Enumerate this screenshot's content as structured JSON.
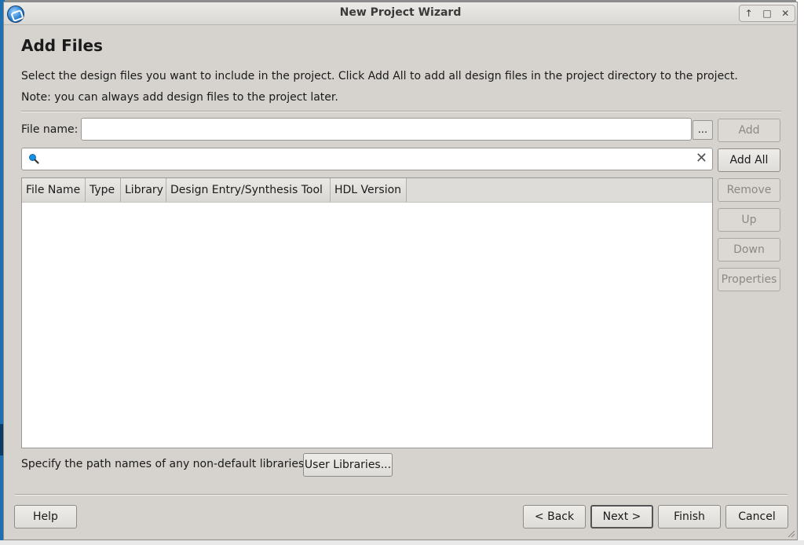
{
  "window": {
    "title": "New Project Wizard",
    "controls": {
      "up": "↑",
      "maximize": "□",
      "close": "✕"
    }
  },
  "page": {
    "heading": "Add Files",
    "description_line1": "Select the design files you want to include in the project. Click Add All to add all design files in the project directory to the project.",
    "description_line2": "Note: you can always add design files to the project later."
  },
  "file_name": {
    "label": "File name:",
    "value": "",
    "browse_label": "..."
  },
  "search": {
    "value": "",
    "icon": "search-icon",
    "clear_icon": "✕"
  },
  "side_buttons": {
    "add": "Add",
    "add_all": "Add All",
    "remove": "Remove",
    "up": "Up",
    "down": "Down",
    "properties": "Properties"
  },
  "table": {
    "columns": [
      "File Name",
      "Type",
      "Library",
      "Design Entry/Synthesis Tool",
      "HDL Version"
    ],
    "rows": []
  },
  "libraries": {
    "text": "Specify the path names of any non-default libraries.",
    "button_label": "User Libraries..."
  },
  "footer": {
    "help": "Help",
    "back": "< Back",
    "next": "Next >",
    "finish": "Finish",
    "cancel": "Cancel"
  },
  "colors": {
    "dialog_background": "#d6d3ce",
    "search_icon": "#1a8fe0"
  }
}
